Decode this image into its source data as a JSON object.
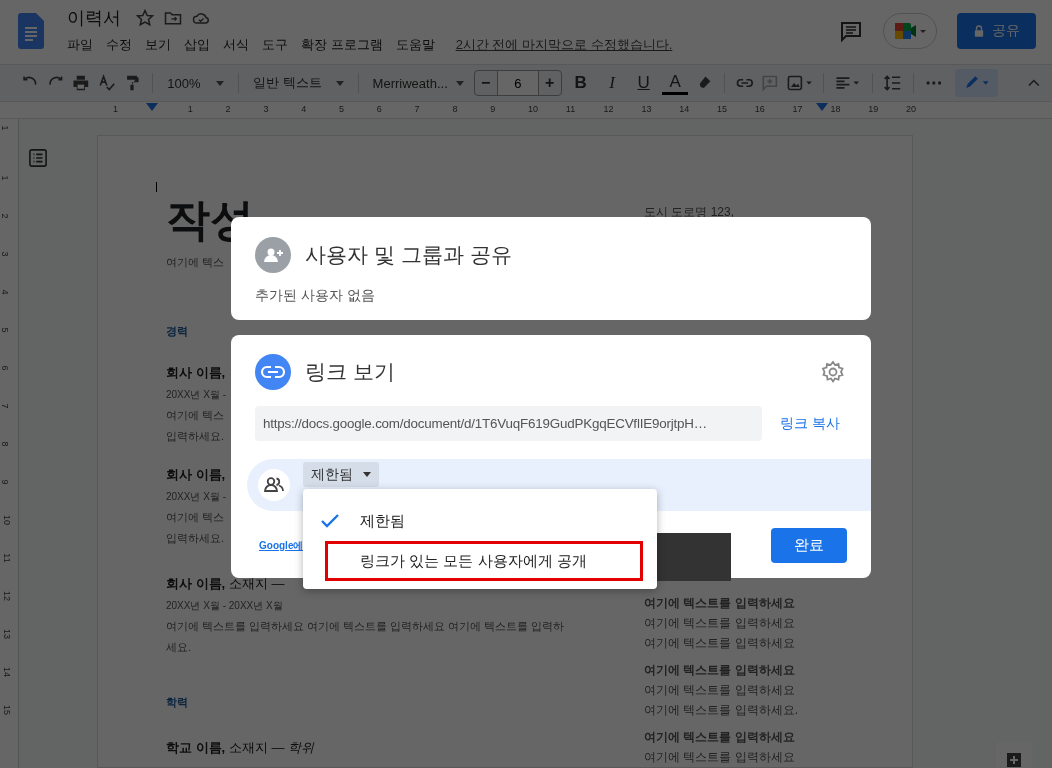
{
  "app": {
    "title": "이력서",
    "menus": [
      "파일",
      "수정",
      "보기",
      "삽입",
      "서식",
      "도구",
      "확장 프로그램",
      "도움말"
    ],
    "last_edit": "2시간 전에 마지막으로 수정했습니다.",
    "share_button": "공유"
  },
  "toolbar": {
    "zoom": "100%",
    "style": "일반 텍스트",
    "font": "Merriweath...",
    "font_size": "6",
    "minus": "−",
    "plus": "+",
    "format": [
      "B",
      "I",
      "U",
      "A"
    ]
  },
  "ruler": {
    "horizontal": [
      "1",
      "1",
      "2",
      "3",
      "4",
      "5",
      "6",
      "7",
      "8",
      "9",
      "10",
      "11",
      "12",
      "13",
      "14",
      "15",
      "16",
      "17",
      "18",
      "19",
      "20"
    ],
    "vertical": [
      "1",
      "1",
      "2",
      "3",
      "4",
      "5",
      "6",
      "7",
      "8",
      "9",
      "10",
      "11",
      "12",
      "13",
      "14",
      "15"
    ]
  },
  "document": {
    "title": "작성",
    "address": "도시 도로명 123,",
    "left": [
      {
        "kind": "intro",
        "text": "여기에 텍스"
      },
      {
        "kind": "heading",
        "text": "경력"
      },
      {
        "kind": "job-name",
        "text": "회사 이름,"
      },
      {
        "kind": "date",
        "text": "20XX년 X월 -"
      },
      {
        "kind": "body",
        "text": "여기에 텍스"
      },
      {
        "kind": "body",
        "text": "입력하세요."
      },
      {
        "kind": "job-name",
        "text": "회사 이름,"
      },
      {
        "kind": "date",
        "text": "20XX년 X월 -"
      },
      {
        "kind": "body",
        "text": "여기에 텍스"
      },
      {
        "kind": "body",
        "text": "입력하세요."
      },
      {
        "kind": "job",
        "text": "**회사 이름,** 소재지 —"
      },
      {
        "kind": "date",
        "text": "20XX년 X월 - 20XX년 X월"
      },
      {
        "kind": "body",
        "text": "여기에 텍스트를 입력하세요 여기에 텍스트를 입력하세요 여기에 텍스트를 입력하세요."
      },
      {
        "kind": "heading",
        "text": "학력"
      },
      {
        "kind": "job",
        "text": "**학교 이름,** 소재지 — *학위*"
      }
    ],
    "right": [
      {
        "title": "여기에 텍스트를 입력하세요",
        "lines": [
          "여기에 텍스트를 입력하세요",
          "여기에 텍스트를 입력하세요"
        ]
      },
      {
        "title": "여기에 텍스트를 입력하세요",
        "lines": [
          "여기에 텍스트를 입력하세요",
          "여기에 텍스트를 입력하세요."
        ]
      },
      {
        "title": "여기에 텍스트를 입력하세요",
        "lines": [
          "여기에 텍스트를 입력하세요"
        ]
      }
    ]
  },
  "share_dialog": {
    "title": "사용자 및 그룹과 공유",
    "subtitle": "추가된 사용자 없음"
  },
  "link_dialog": {
    "title": "링크 보기",
    "url": "https://docs.google.com/document/d/1T6VuqF619GudPKgqECVflIE9orjtpH…",
    "copy_link": "링크 복사",
    "access": "제한됨",
    "footer_link": "Google에",
    "done": "완료"
  },
  "access_menu": [
    {
      "label": "제한됨",
      "selected": true,
      "highlighted": false
    },
    {
      "label": "링크가 있는 모든 사용자에게 공개",
      "selected": false,
      "highlighted": true
    }
  ]
}
